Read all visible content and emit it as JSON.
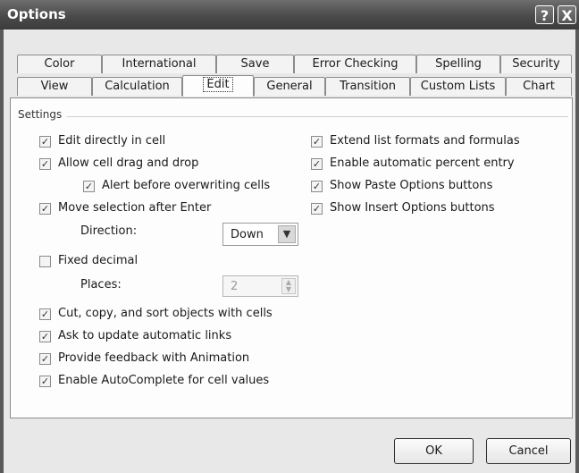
{
  "window": {
    "title": "Options"
  },
  "titlebar_buttons": {
    "help": "?",
    "close": "X"
  },
  "tabs_top": [
    "Color",
    "International",
    "Save",
    "Error Checking",
    "Spelling",
    "Security"
  ],
  "tabs_bottom": [
    "View",
    "Calculation",
    "Edit",
    "General",
    "Transition",
    "Custom Lists",
    "Chart"
  ],
  "active_tab": "Edit",
  "settings": {
    "group_label": "Settings",
    "left": [
      {
        "label": "Edit directly in cell",
        "checked": true
      },
      {
        "label": "Allow cell drag and drop",
        "checked": true
      },
      {
        "label": "Alert before overwriting cells",
        "checked": true
      },
      {
        "label": "Move selection after Enter",
        "checked": true
      },
      {
        "label": "Fixed decimal",
        "checked": false
      },
      {
        "label": "Cut, copy, and sort objects with cells",
        "checked": true
      },
      {
        "label": "Ask to update automatic links",
        "checked": true
      },
      {
        "label": "Provide feedback with Animation",
        "checked": true
      },
      {
        "label": "Enable AutoComplete for cell values",
        "checked": true
      }
    ],
    "right": [
      {
        "label": "Extend list formats and formulas",
        "checked": true
      },
      {
        "label": "Enable automatic percent entry",
        "checked": true
      },
      {
        "label": "Show Paste Options buttons",
        "checked": true
      },
      {
        "label": "Show Insert Options buttons",
        "checked": true
      }
    ],
    "direction": {
      "label": "Direction:",
      "value": "Down"
    },
    "places": {
      "label": "Places:",
      "value": "2"
    }
  },
  "buttons": {
    "ok": "OK",
    "cancel": "Cancel"
  },
  "check_glyph": "✓"
}
